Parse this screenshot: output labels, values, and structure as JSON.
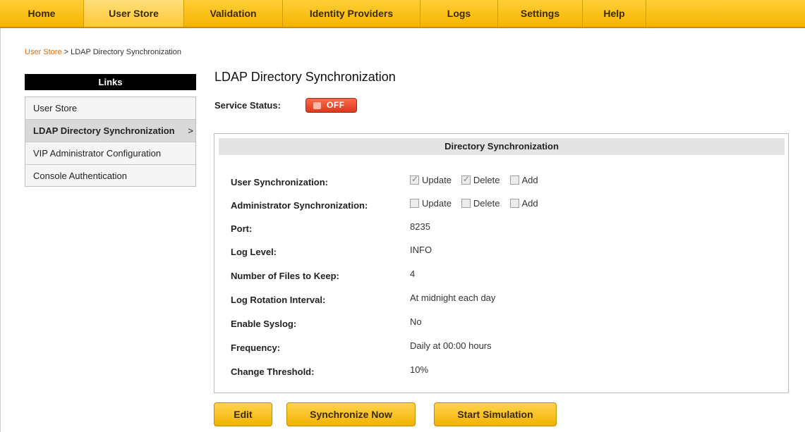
{
  "nav": {
    "tabs": [
      {
        "label": "Home"
      },
      {
        "label": "User Store"
      },
      {
        "label": "Validation"
      },
      {
        "label": "Identity Providers"
      },
      {
        "label": "Logs"
      },
      {
        "label": "Settings"
      },
      {
        "label": "Help"
      }
    ],
    "active_tab": "User Store"
  },
  "breadcrumb": {
    "link": "User Store",
    "separator": " > ",
    "current": "LDAP Directory Synchronization"
  },
  "sidebar": {
    "header": "Links",
    "items": [
      {
        "label": "User Store"
      },
      {
        "label": "LDAP Directory Synchronization",
        "chevron": ">"
      },
      {
        "label": "VIP Administrator Configuration"
      },
      {
        "label": "Console Authentication"
      }
    ]
  },
  "main": {
    "title": "LDAP Directory Synchronization",
    "service_status_label": "Service Status:",
    "service_status_value": "OFF",
    "panel": {
      "header": "Directory Synchronization",
      "user_sync": {
        "label": "User Synchronization:",
        "options": [
          {
            "label": "Update",
            "checked": true
          },
          {
            "label": "Delete",
            "checked": true
          },
          {
            "label": "Add",
            "checked": false
          }
        ]
      },
      "admin_sync": {
        "label": "Administrator Synchronization:",
        "options": [
          {
            "label": "Update",
            "checked": false
          },
          {
            "label": "Delete",
            "checked": false
          },
          {
            "label": "Add",
            "checked": false
          }
        ]
      },
      "fields": [
        {
          "label": "Port:",
          "value": "8235"
        },
        {
          "label": "Log Level:",
          "value": "INFO"
        },
        {
          "label": "Number of Files to Keep:",
          "value": "4"
        },
        {
          "label": "Log Rotation Interval:",
          "value": "At midnight each day"
        },
        {
          "label": "Enable Syslog:",
          "value": "No"
        },
        {
          "label": "Frequency:",
          "value": "Daily at 00:00 hours"
        },
        {
          "label": "Change Threshold:",
          "value": "10%"
        }
      ]
    },
    "buttons": {
      "edit": "Edit",
      "sync_now": "Synchronize Now",
      "simulate": "Start Simulation"
    }
  },
  "colors": {
    "nav_bg": "#f6b400",
    "link_orange": "#e06800",
    "status_off": "#d93a1b"
  }
}
